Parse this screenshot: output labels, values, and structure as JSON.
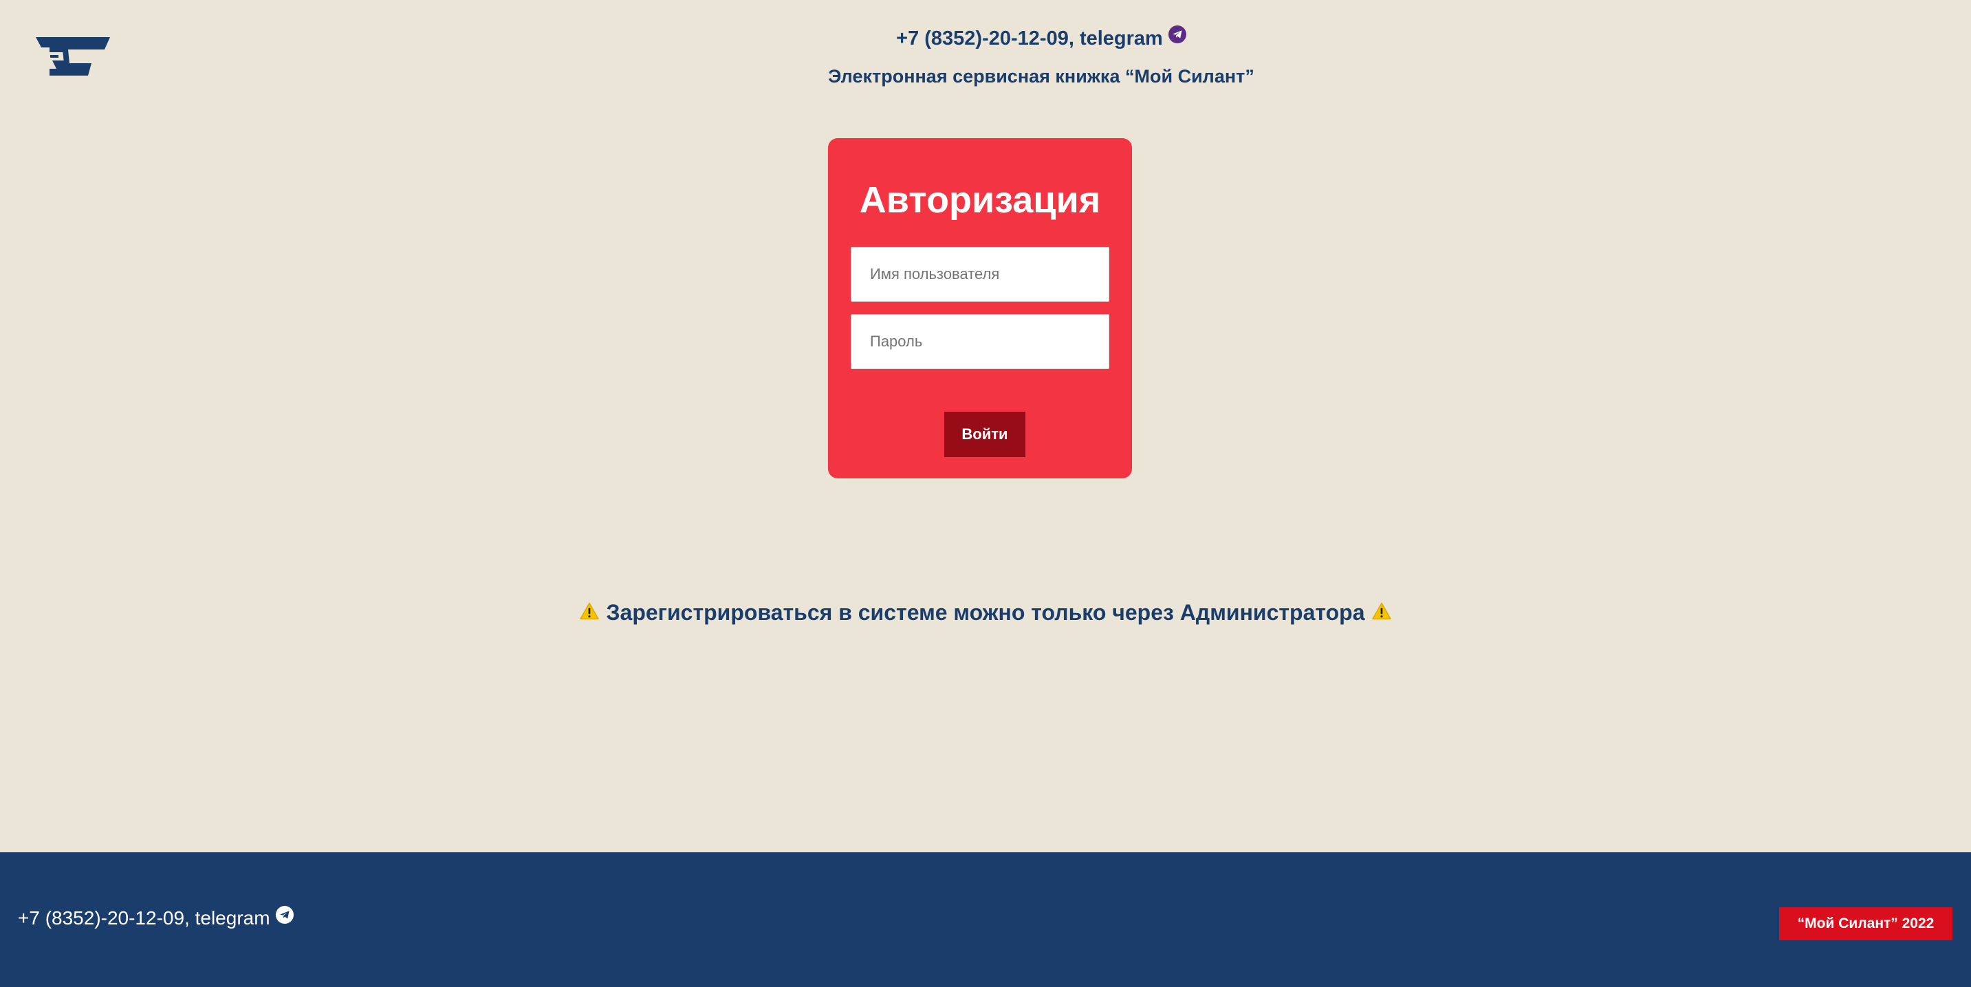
{
  "header": {
    "logo_icon": "silant-logo-icon",
    "phone": "+7 (8352)-20-12-09, telegram",
    "telegram_icon": "telegram-icon",
    "subtitle": "Электронная сервисная книжка “Мой Силант”"
  },
  "auth": {
    "title": "Авторизация",
    "username_placeholder": "Имя пользователя",
    "username_value": "",
    "password_placeholder": "Пароль",
    "password_value": "",
    "login_label": "Войти"
  },
  "notice": {
    "icon": "warning-icon",
    "text": "Зарегистрироваться в системе можно только через Администратора"
  },
  "footer": {
    "phone": "+7 (8352)-20-12-09, telegram",
    "telegram_icon": "telegram-icon",
    "copyright": "“Мой Силант” 2022"
  },
  "colors": {
    "background": "#EBE5D8",
    "primary_blue": "#1A3D6B",
    "card_red": "#F33443",
    "button_dark_red": "#980C17",
    "badge_red": "#D90F1E",
    "telegram_header_icon": "#5B2C83"
  }
}
